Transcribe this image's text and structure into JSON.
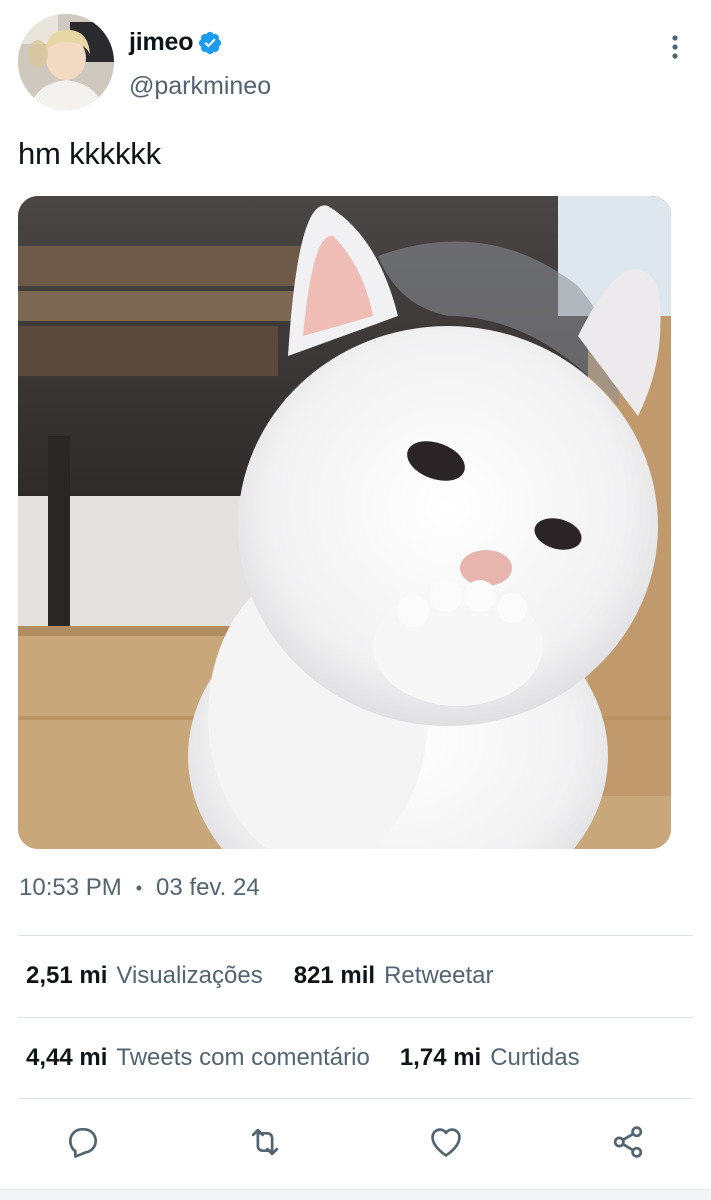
{
  "author": {
    "display_name": "jimeo",
    "handle": "@parkmineo",
    "verified": true,
    "avatar_icon": "profile-photo"
  },
  "tweet": {
    "text": "hm kkkkkk",
    "media_description_icon": "white-kitten-photo",
    "time": "10:53 PM",
    "separator": "•",
    "date": "03 fev. 24"
  },
  "stats": {
    "views_value": "2,51 mi",
    "views_label": "Visualizações",
    "retweets_value": "821 mil",
    "retweets_label": "Retweetar",
    "quotes_value": "4,44 mi",
    "quotes_label": "Tweets com comentário",
    "likes_value": "1,74 mi",
    "likes_label": "Curtidas"
  },
  "actions": [
    "reply-icon",
    "retweet-icon",
    "like-icon",
    "share-icon"
  ],
  "colors": {
    "text_primary": "#0f1419",
    "text_secondary": "#536471",
    "verified_blue": "#1d9bf0",
    "icon_gray": "#536471",
    "divider": "#dfe3e6"
  }
}
